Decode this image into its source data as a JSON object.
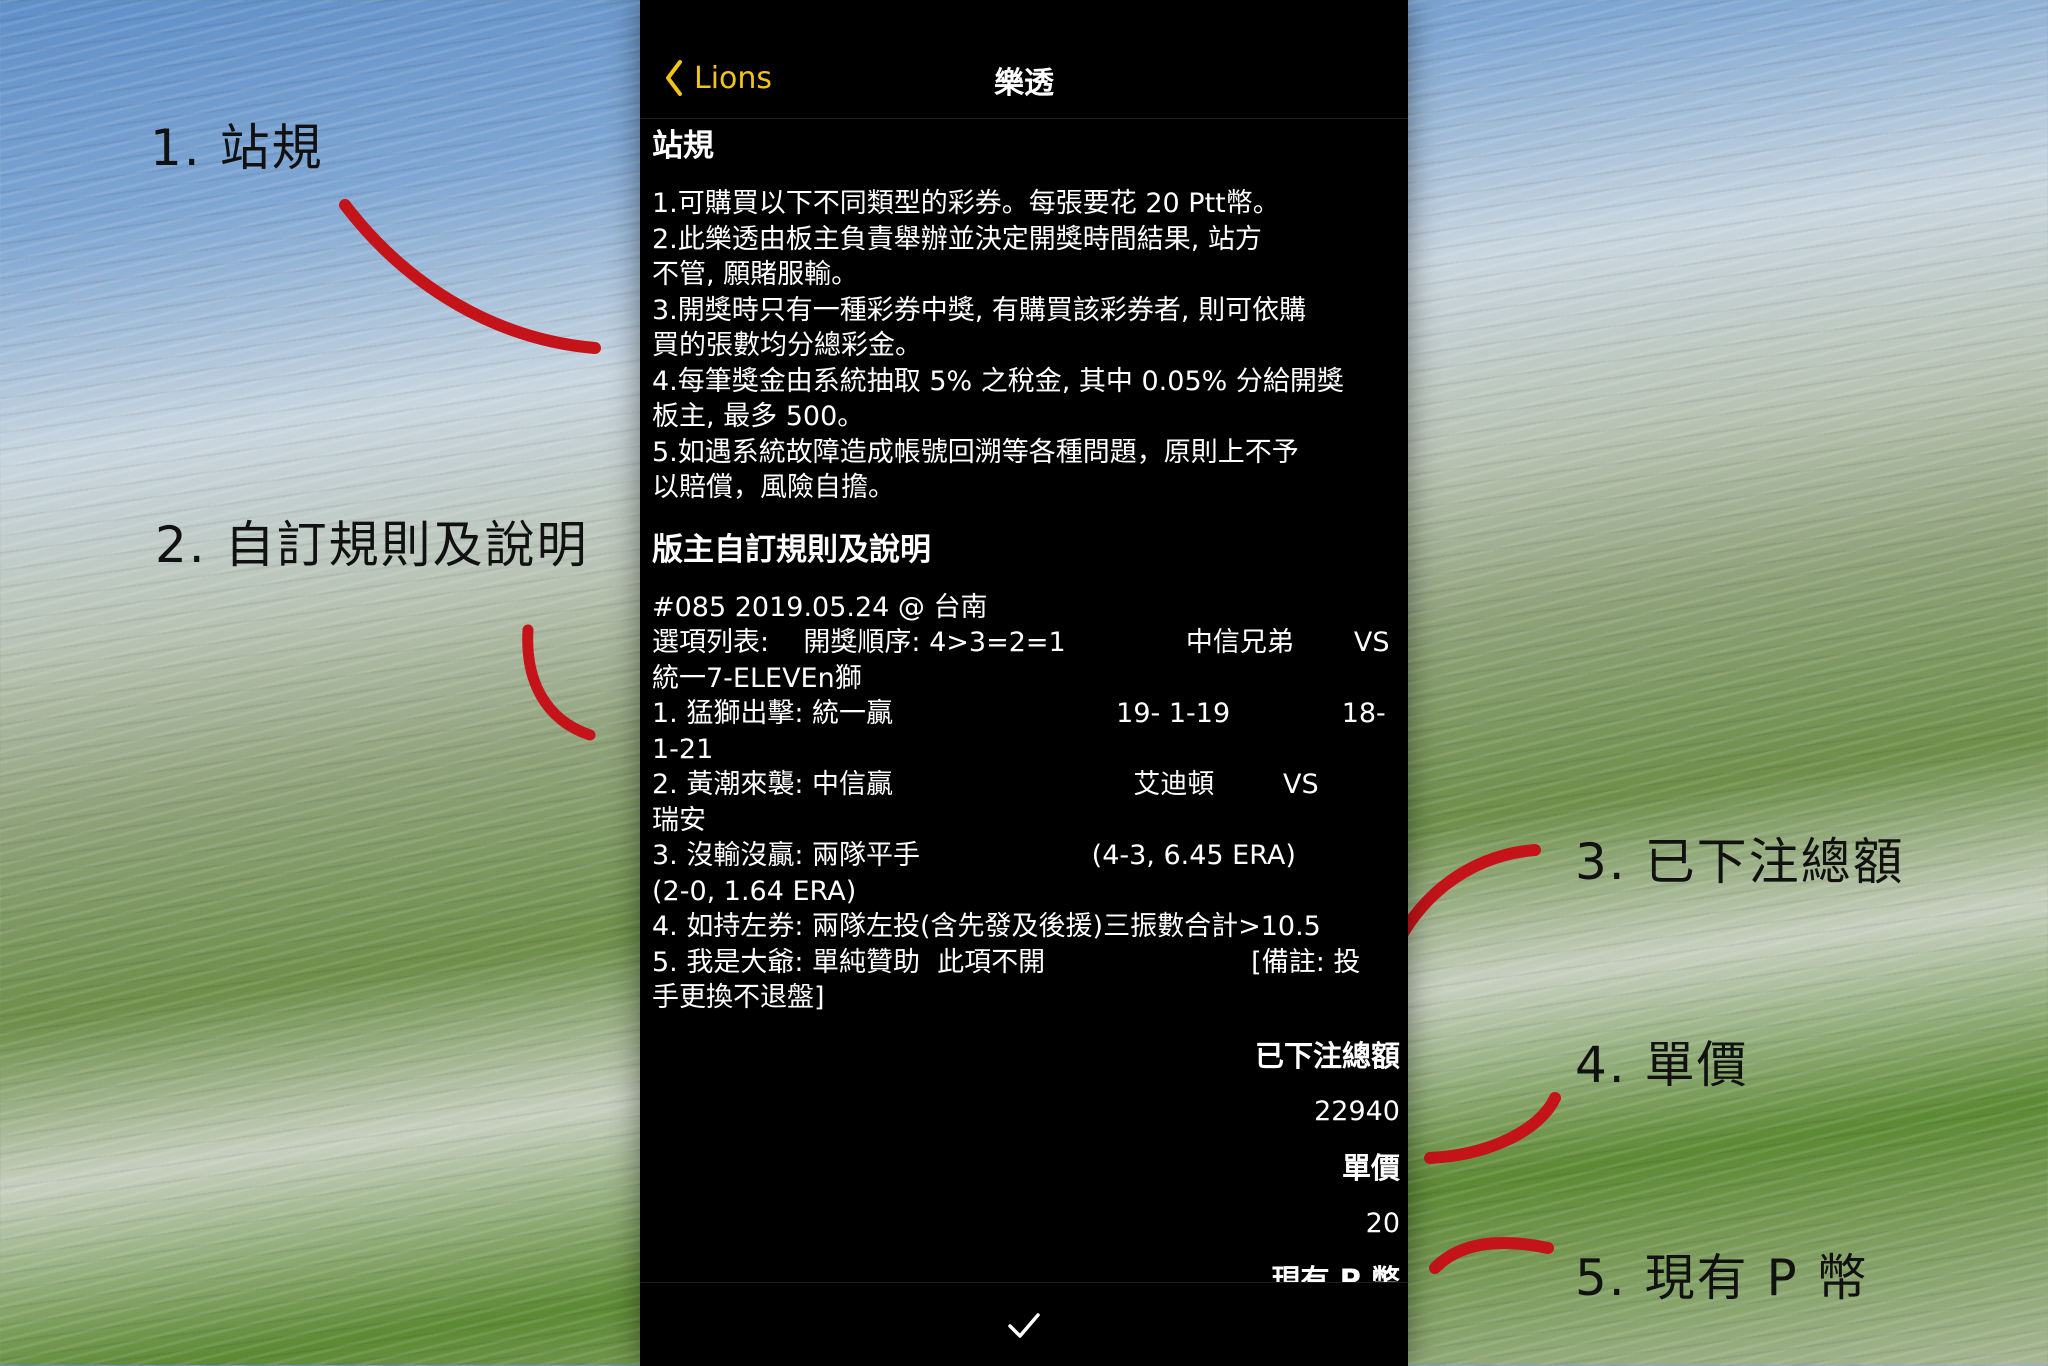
{
  "annotations": [
    {
      "label": "1. 站規"
    },
    {
      "label": "2. 自訂規則及說明"
    },
    {
      "label": "3. 已下注總額"
    },
    {
      "label": "4. 單價"
    },
    {
      "label": "5. 現有 P 幣"
    }
  ],
  "colors": {
    "accent": "#f0c418",
    "annotation_stroke": "#c4141a"
  },
  "navbar": {
    "back_label": "Lions",
    "title": "樂透",
    "back_icon": "chevron-left-icon"
  },
  "site_rules": {
    "heading": "站規",
    "lines": [
      "1.可購買以下不同類型的彩券。每張要花 20 Ptt幣。",
      "2.此樂透由板主負責舉辦並決定開獎時間結果, 站方",
      "不管, 願賭服輸。",
      "3.開獎時只有一種彩券中獎, 有購買該彩券者, 則可依購",
      "買的張數均分總彩金。",
      "4.每筆獎金由系統抽取 5% 之稅金, 其中 0.05% 分給開獎",
      "板主, 最多 500。",
      "5.如遇系統故障造成帳號回溯等各種問題，原則上不予",
      "以賠償，風險自擔。"
    ]
  },
  "custom_rules": {
    "heading": "版主自訂規則及說明",
    "lines": [
      "#085 2019.05.24 @ 台南",
      "選項列表:    開獎順序: 4>3=2=1              中信兄弟       VS",
      "統一7-ELEVEn獅",
      "1. 猛獅出擊: 統一贏                          19- 1-19             18-",
      "1-21",
      "2. 黃潮來襲: 中信贏                            艾迪頓        VS",
      "瑞安",
      "3. 沒輸沒贏: 兩隊平手                    (4-3, 6.45 ERA)",
      "(2-0, 1.64 ERA)",
      "4. 如持左券: 兩隊左投(含先發及後援)三振數合計>10.5",
      "5. 我是大爺: 單純贊助  此項不開                        [備註: 投",
      "手更換不退盤]"
    ]
  },
  "total_bet": {
    "label": "已下注總額",
    "value": "22940"
  },
  "unit_price": {
    "label": "單價",
    "value": "20"
  },
  "current_p": {
    "label": "現有 P 幣"
  },
  "bottom": {
    "confirm_icon": "checkmark-icon"
  }
}
